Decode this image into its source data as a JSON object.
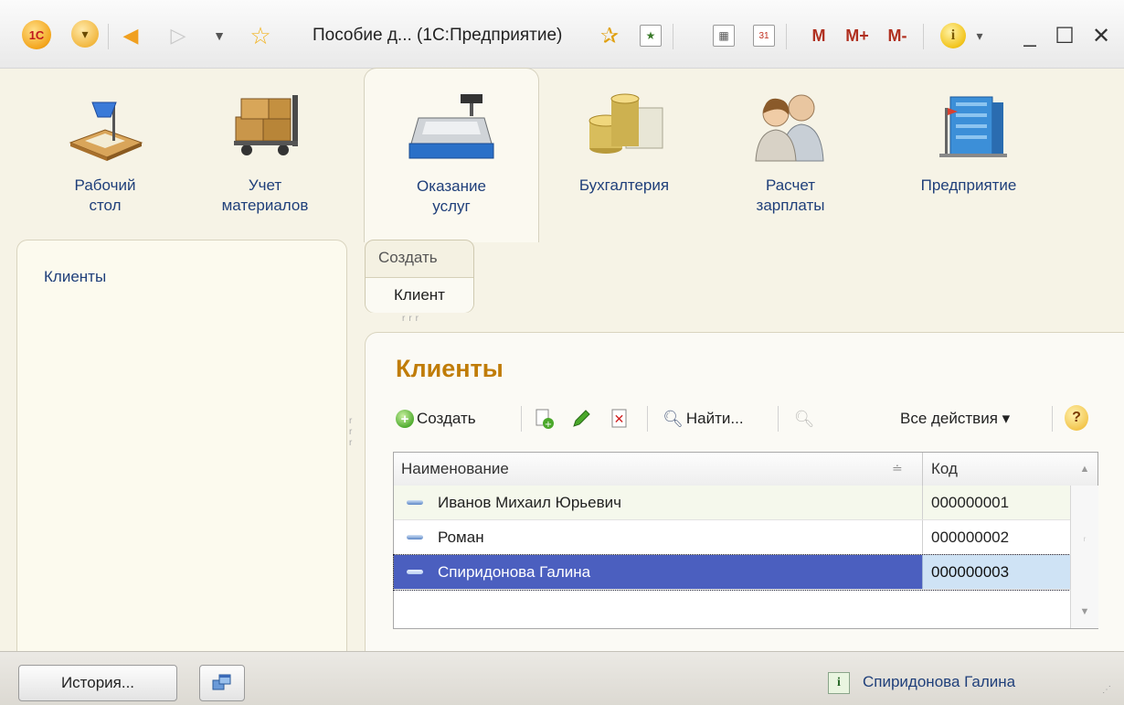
{
  "window": {
    "title": "Пособие д... (1С:Предприятие)",
    "logo_text": "1С",
    "memory_buttons": [
      "M",
      "M+",
      "M-"
    ],
    "controls": [
      "_",
      "☐",
      "✕"
    ]
  },
  "sections": [
    {
      "id": "desktop",
      "label": "Рабочий стол"
    },
    {
      "id": "materials",
      "label": "Учет материалов"
    },
    {
      "id": "services",
      "label": "Оказание услуг",
      "active": true
    },
    {
      "id": "accounting",
      "label": "Бухгалтерия"
    },
    {
      "id": "salary",
      "label": "Расчет зарплаты"
    },
    {
      "id": "enterprise",
      "label": "Предприятие"
    }
  ],
  "navigation": {
    "items": [
      "Клиенты"
    ]
  },
  "create_panel": {
    "header": "Создать",
    "items": [
      "Клиент"
    ]
  },
  "form": {
    "title": "Клиенты",
    "toolbar": {
      "create": "Создать",
      "find": "Найти...",
      "all_actions": "Все действия ▾",
      "help": "?"
    },
    "columns": [
      "Наименование",
      "Код"
    ],
    "rows": [
      {
        "name": "Иванов Михаил Юрьевич",
        "code": "000000001"
      },
      {
        "name": "Роман",
        "code": "000000002"
      },
      {
        "name": "Спиридонова Галина",
        "code": "000000003",
        "selected": true
      }
    ]
  },
  "status_bar": {
    "history_button": "История...",
    "current_item": "Спиридонова Галина"
  },
  "colors": {
    "title_accent": "#c07c07",
    "link_text": "#1f3f7a",
    "selection": "#4b5fbf",
    "panel_bg": "#f6f3e6"
  }
}
